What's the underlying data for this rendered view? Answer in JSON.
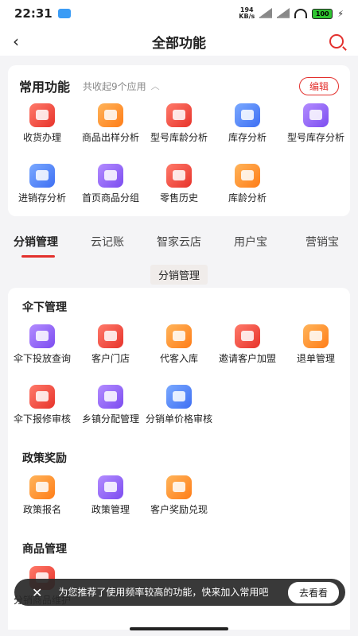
{
  "status": {
    "time": "22:31",
    "net_speed_top": "194",
    "net_speed_bottom": "KB/s",
    "battery": "100"
  },
  "nav": {
    "title": "全部功能"
  },
  "favorites": {
    "title": "常用功能",
    "count_text": "共收起9个应用",
    "edit_label": "编辑",
    "items": [
      {
        "label": "收货办理",
        "color": "red"
      },
      {
        "label": "商品出样分析",
        "color": "orange"
      },
      {
        "label": "型号库龄分析",
        "color": "red"
      },
      {
        "label": "库存分析",
        "color": "blue"
      },
      {
        "label": "型号库存分析",
        "color": "purple"
      },
      {
        "label": "进销存分析",
        "color": "blue"
      },
      {
        "label": "首页商品分组",
        "color": "purple"
      },
      {
        "label": "零售历史",
        "color": "red"
      },
      {
        "label": "库龄分析",
        "color": "orange"
      }
    ]
  },
  "tabs": [
    {
      "label": "分销管理",
      "active": true
    },
    {
      "label": "云记账"
    },
    {
      "label": "智家云店"
    },
    {
      "label": "用户宝"
    },
    {
      "label": "营销宝"
    }
  ],
  "section_chip": "分销管理",
  "groups": [
    {
      "title": "伞下管理",
      "items": [
        {
          "label": "伞下投放查询",
          "color": "purple"
        },
        {
          "label": "客户门店",
          "color": "red"
        },
        {
          "label": "代客入库",
          "color": "orange"
        },
        {
          "label": "邀请客户加盟",
          "color": "red"
        },
        {
          "label": "退单管理",
          "color": "orange"
        },
        {
          "label": "伞下报修审核",
          "color": "red"
        },
        {
          "label": "乡镇分配管理",
          "color": "purple"
        },
        {
          "label": "分销单价格审核",
          "color": "blue"
        }
      ]
    },
    {
      "title": "政策奖励",
      "items": [
        {
          "label": "政策报名",
          "color": "orange"
        },
        {
          "label": "政策管理",
          "color": "purple"
        },
        {
          "label": "客户奖励兑现",
          "color": "orange"
        }
      ]
    },
    {
      "title": "商品管理",
      "items": [
        {
          "label": "分销商品维护",
          "color": "red"
        }
      ]
    }
  ],
  "toast": {
    "text": "为您推荐了使用频率较高的功能，快来加入常用吧",
    "button": "去看看"
  },
  "colors": {
    "accent": "#e3302d"
  }
}
